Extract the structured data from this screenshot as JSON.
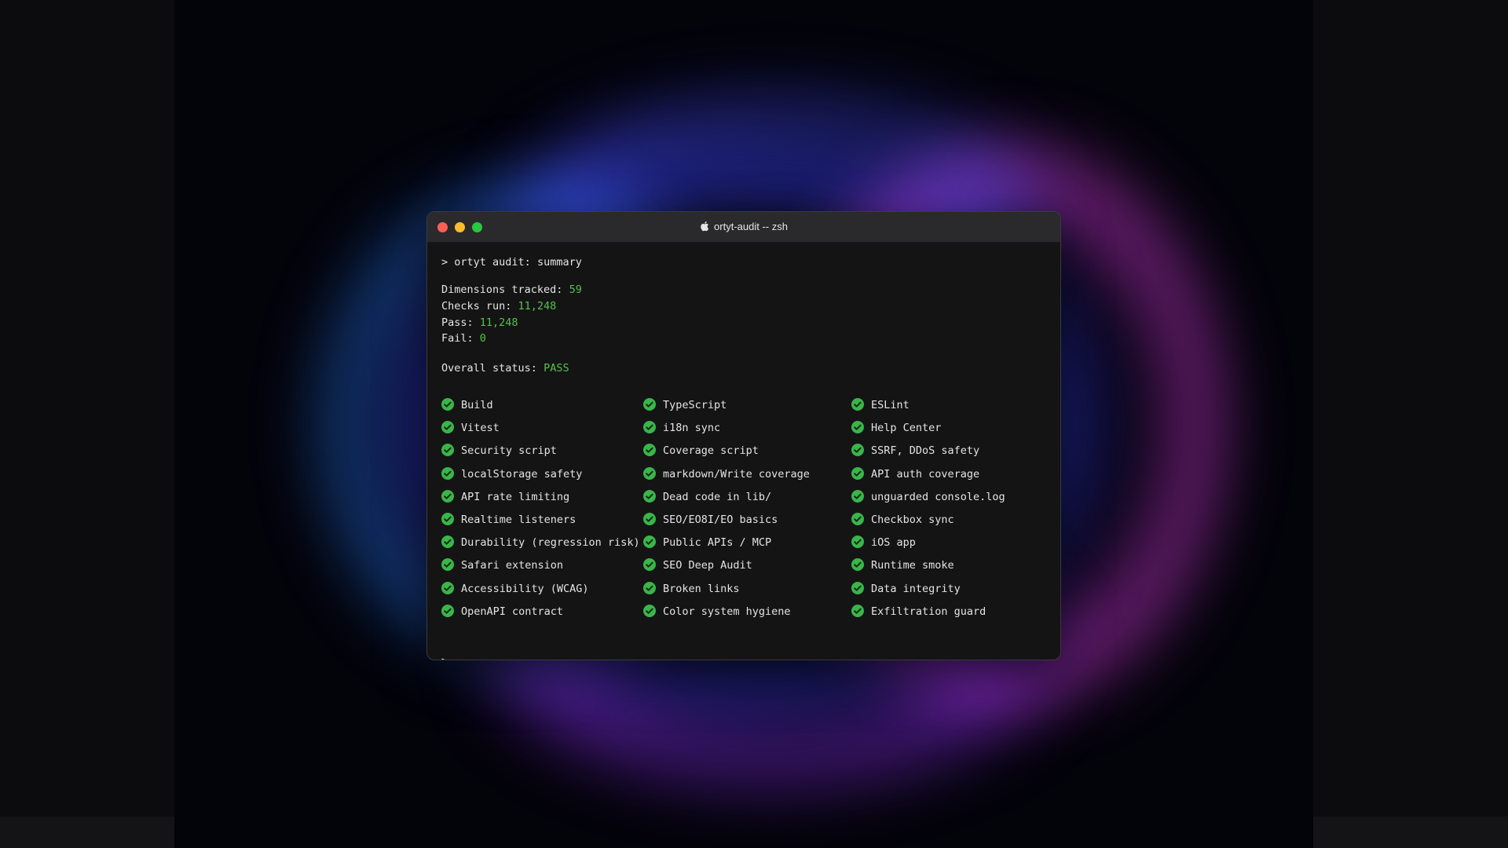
{
  "window": {
    "title": "ortyt-audit -- zsh"
  },
  "terminal": {
    "prompt_symbol": ">",
    "command": "ortyt audit: summary",
    "stats": [
      {
        "label": "Dimensions tracked:",
        "value": "59"
      },
      {
        "label": "Checks run:",
        "value": "11,248"
      },
      {
        "label": "Pass:",
        "value": "11,248"
      },
      {
        "label": "Fail:",
        "value": "0"
      }
    ],
    "status": {
      "label": "Overall status:",
      "value": "PASS"
    },
    "checks_columns": [
      [
        "Build",
        "Vitest",
        "Security script",
        "localStorage safety",
        "API rate limiting",
        "Realtime listeners",
        "Durability (regression risk)",
        "Safari extension",
        "Accessibility (WCAG)",
        "OpenAPI contract"
      ],
      [
        "TypeScript",
        "i18n sync",
        "Coverage script",
        "markdown/Write coverage",
        "Dead code in lib/",
        "SEO/EO8I/EO basics",
        "Public APIs / MCP",
        "SEO Deep Audit",
        "Broken links",
        "Color system hygiene"
      ],
      [
        "ESLint",
        "Help Center",
        "SSRF, DDoS safety",
        "API auth coverage",
        "unguarded console.log",
        "Checkbox sync",
        "iOS app",
        "Runtime smoke",
        "Data integrity",
        "Exfiltration guard"
      ]
    ],
    "final_prompt": ">",
    "cursor": "_"
  },
  "colors": {
    "accent_green": "#54c24a",
    "check_green": "#3bb54a",
    "close": "#fe5f57",
    "minimize": "#febc2e",
    "maximize": "#28c840"
  },
  "icons": {
    "window_title": "apple-logo-icon",
    "check": "check-circle-icon"
  }
}
